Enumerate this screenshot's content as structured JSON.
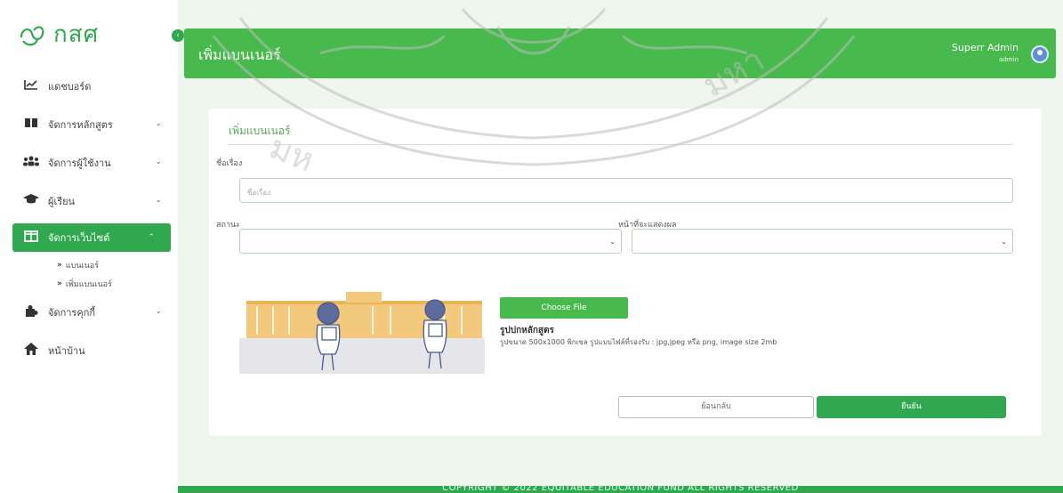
{
  "brand": {
    "logo_text": "กสศ"
  },
  "sidebar": {
    "items": [
      {
        "label": "แดชบอร์ด",
        "icon": "chart-icon",
        "has_children": false,
        "active": false
      },
      {
        "label": "จัดการหลักสูตร",
        "icon": "book-icon",
        "has_children": true,
        "active": false
      },
      {
        "label": "จัดการผู้ใช้งาน",
        "icon": "users-icon",
        "has_children": true,
        "active": false
      },
      {
        "label": "ผู้เรียน",
        "icon": "graduation-cap-icon",
        "has_children": true,
        "active": false
      },
      {
        "label": "จัดการเว็บไซต์",
        "icon": "columns-icon",
        "has_children": true,
        "active": true
      },
      {
        "label": "จัดการคุกกี้",
        "icon": "puzzle-icon",
        "has_children": true,
        "active": false
      },
      {
        "label": "หน้าบ้าน",
        "icon": "home-icon",
        "has_children": false,
        "active": false
      }
    ],
    "subitems": [
      {
        "label": "แบนเนอร์"
      },
      {
        "label": "เพิ่มแบนเนอร์"
      }
    ]
  },
  "header": {
    "title": "เพิ่มแบนเนอร์",
    "user_name": "Superr Admin",
    "user_role": "admin"
  },
  "form": {
    "card_title": "เพิ่มแบนเนอร์",
    "title_label": "ชื่อเรื่อง",
    "title_placeholder": "ชื่อเรื่อง",
    "status_label": "สถานะ",
    "status_value": "",
    "page_label": "หน้าที่จะแสดงผล",
    "page_value": "",
    "choose_file": "Choose File",
    "image_label": "รูปปกหลักสูตร",
    "image_hint": "รูปขนาด 500x1000 พิกเซล รูปแบบไฟล์ที่รองรับ : jpg,jpeg หรือ png, image size 2mb",
    "cancel_label": "ย้อนกลับ",
    "submit_label": "ยืนยัน"
  },
  "footer": {
    "text": "COPYRIGHT © 2022 EQUITABLE EDUCATION FUND ALL RIGHTS RESERVED"
  },
  "colors": {
    "primary": "#2fa84f",
    "header": "#48b94d",
    "background": "#eef6ee"
  }
}
